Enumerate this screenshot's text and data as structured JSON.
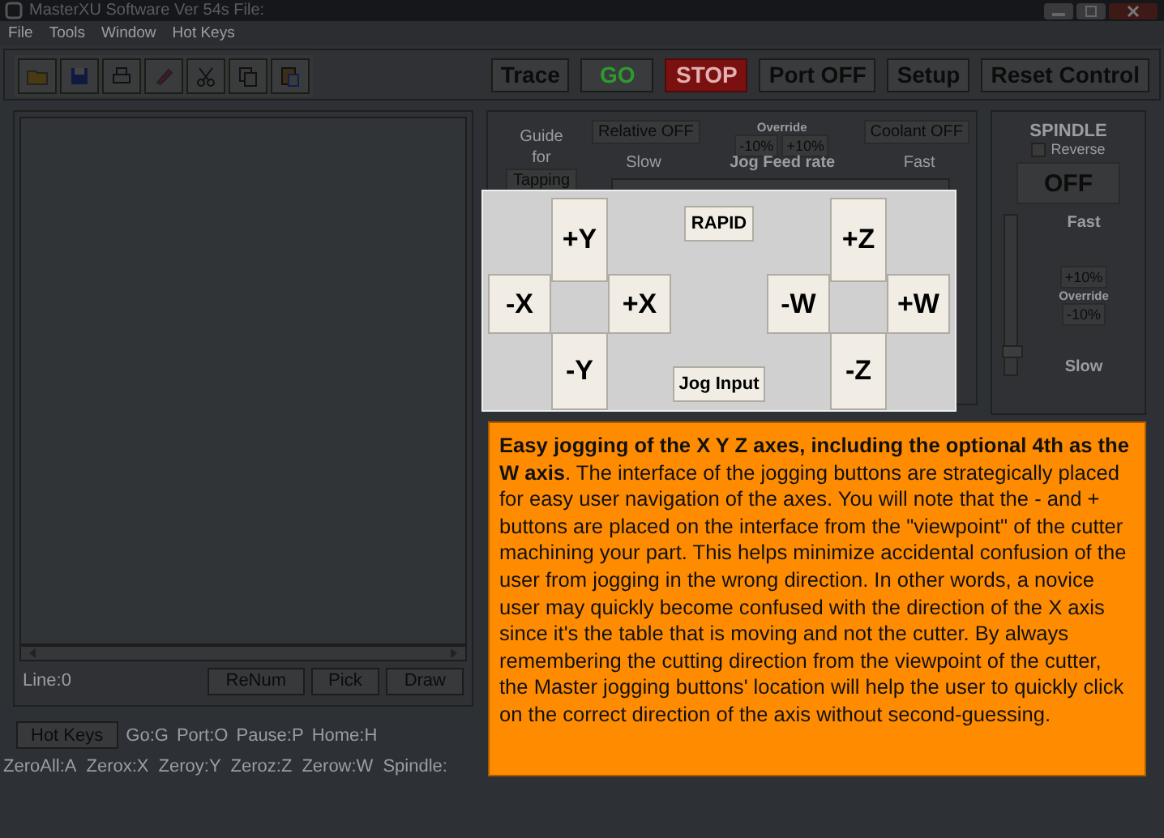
{
  "window": {
    "title": "MasterXU Software Ver 54s File:"
  },
  "menu": [
    "File",
    "Tools",
    "Window",
    "Hot Keys"
  ],
  "toolbar_buttons": [
    {
      "label": "Trace",
      "kind": "plain"
    },
    {
      "label": "GO",
      "kind": "go"
    },
    {
      "label": "STOP",
      "kind": "stop"
    },
    {
      "label": "Port OFF",
      "kind": "plain"
    },
    {
      "label": "Setup",
      "kind": "plain"
    },
    {
      "label": "Reset Control",
      "kind": "plain"
    }
  ],
  "program": {
    "line": "Line:0",
    "buttons": [
      "ReNum",
      "Pick",
      "Draw"
    ]
  },
  "hot_keys": {
    "button": "Hot Keys",
    "keys": [
      "Go:G",
      "Port:O",
      "Pause:P",
      "Home:H"
    ],
    "keys_row_2": [
      "ZeroAll:A",
      "Zerox:X",
      "Zeroy:Y",
      "Zeroz:Z",
      "Zerow:W",
      "Spindle:"
    ]
  },
  "jog_controls": {
    "guide": "Guide for",
    "tapping": "Tapping",
    "relative": "Relative OFF",
    "override_label": "Override",
    "override_buttons": [
      "-10%",
      "+10%"
    ],
    "coolant": "Coolant OFF",
    "slow": "Slow",
    "feed_label": "Jog Feed rate",
    "fast": "Fast"
  },
  "spindle": {
    "title": "SPINDLE",
    "reverse": {
      "label": "Reverse",
      "checked": false
    },
    "state_button": "OFF",
    "fast": "Fast",
    "override_buttons": [
      "+10%",
      "-10%"
    ],
    "override_label": "Override",
    "slow": "Slow",
    "level": 0.1
  },
  "jog_pad": {
    "rapid": "RAPID",
    "jog_input": "Jog Input",
    "xy": {
      "up": "+Y",
      "left": "-X",
      "right": "+X",
      "down": "-Y"
    },
    "zw": {
      "up": "+Z",
      "left": "-W",
      "right": "+W",
      "down": "-Z"
    }
  },
  "callout": {
    "text": "**Easy jogging of the X Y Z axes, including the optional 4th as the W axis**. The interface of the jogging buttons are strategically placed for easy user navigation of the axes. You will note that the - and + buttons are placed on the interface from the \"viewpoint\" of the cutter machining your part. This helps minimize accidental confusion of the user from jogging in the wrong direction. In other words, a novice user may quickly become confused with the direction of the X axis since it's the table that is moving and not the cutter. By always remembering the cutting direction from the viewpoint of the cutter, the Master jogging buttons' location will help the user to quickly click on the correct direction of the axis without second-guessing."
  }
}
